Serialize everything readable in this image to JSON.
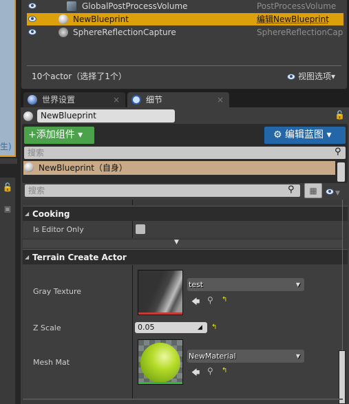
{
  "outliner": {
    "rows": [
      {
        "name": "GlobalPostProcessVolume",
        "type": "PostProcessVolume",
        "selected": false
      },
      {
        "name": "NewBlueprint",
        "type": "编辑NewBlueprint",
        "selected": true
      },
      {
        "name": "SphereReflectionCapture",
        "type": "SphereReflectionCaptur",
        "selected": false
      }
    ],
    "actor_count": "10个actor（选择了1个）",
    "view_options": "视图选项▾"
  },
  "left_strip": {
    "viewport_text": "生)"
  },
  "tabs": [
    {
      "label": "世界设置",
      "close": "×",
      "icon": "globe-icon"
    },
    {
      "label": "细节",
      "close": "×",
      "icon": "details-info-icon"
    }
  ],
  "details": {
    "object_name": "NewBlueprint",
    "add_component": "+添加组件 ▾",
    "edit_blueprint": "⚙ 编辑蓝图 ▾",
    "component_search_placeholder": "搜索",
    "component_self": "NewBlueprint（自身）",
    "property_search_placeholder": "搜索",
    "lock_glyph": "🔓",
    "search_glyph": "⚲",
    "grid_glyph": "▦",
    "advanced_glyph": "▼"
  },
  "categories": [
    {
      "title": "Cooking",
      "properties": [
        {
          "label": "Is Editor Only",
          "type": "checkbox",
          "checked": false
        }
      ]
    },
    {
      "title": "Terrain Create Actor",
      "properties": [
        {
          "label": "Gray Texture",
          "type": "asset",
          "value": "test",
          "asset_kind": "texture"
        },
        {
          "label": "Z Scale",
          "type": "number",
          "value": "0.05"
        },
        {
          "label": "Mesh Mat",
          "type": "asset",
          "value": "NewMaterial",
          "asset_kind": "material"
        }
      ]
    }
  ],
  "asset_actions": {
    "use": "🡄",
    "find": "⚲",
    "reset": "↰"
  },
  "colors": {
    "selection": "#dca10a",
    "add_component": "#4ba24b",
    "edit_blueprint": "#2467a8",
    "component_self": "#c8aa88",
    "texture_bar": "#c23b3b",
    "material_bar": "#35b53a",
    "reset_arrow": "#e8e800"
  }
}
